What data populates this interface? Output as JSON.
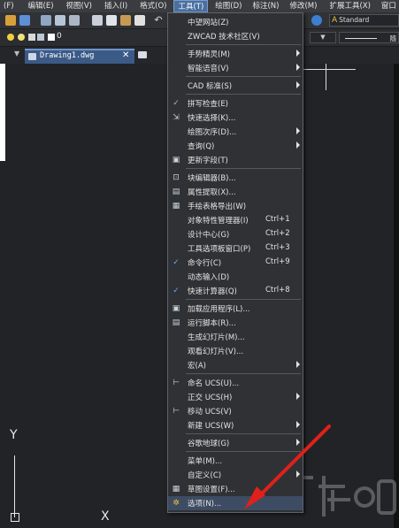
{
  "menubar": {
    "items": [
      "(F)",
      "编辑(E)",
      "视图(V)",
      "插入(I)",
      "格式(O)",
      "工具(T)",
      "绘图(D)",
      "标注(N)",
      "修改(M)",
      "扩展工具(X)",
      "窗口"
    ],
    "active_index": 5
  },
  "toolbar": {
    "text_style": "Standard",
    "undo_icon": "undo-icon"
  },
  "layerbar": {
    "current_layer": "0",
    "lineweight_label": "随"
  },
  "tabs": [
    {
      "label": "Drawing1.dwg"
    }
  ],
  "canvas": {
    "ucs_y": "Y",
    "ucs_x": "X"
  },
  "tools_menu": {
    "items": [
      {
        "label": "中望网站(Z)",
        "shortcut": "",
        "submenu": false,
        "icon": ""
      },
      {
        "label": "ZWCAD 技术社区(V)",
        "shortcut": "",
        "submenu": false,
        "icon": ""
      },
      {
        "label": "手势精灵(M)",
        "shortcut": "",
        "submenu": true,
        "icon": ""
      },
      {
        "label": "智能语音(V)",
        "shortcut": "",
        "submenu": true,
        "icon": ""
      },
      {
        "label": "CAD 标准(S)",
        "shortcut": "",
        "submenu": true,
        "icon": ""
      },
      {
        "label": "拼写检查(E)",
        "shortcut": "",
        "submenu": false,
        "icon": "spell-check-icon"
      },
      {
        "label": "快速选择(K)...",
        "shortcut": "",
        "submenu": false,
        "icon": "quick-select-icon"
      },
      {
        "label": "绘图次序(D)...",
        "shortcut": "",
        "submenu": true,
        "icon": ""
      },
      {
        "label": "查询(Q)",
        "shortcut": "",
        "submenu": true,
        "icon": ""
      },
      {
        "label": "更新字段(T)",
        "shortcut": "",
        "submenu": false,
        "icon": "update-field-icon"
      },
      {
        "label": "块编辑器(B)...",
        "shortcut": "",
        "submenu": false,
        "icon": "block-editor-icon"
      },
      {
        "label": "属性提取(X)...",
        "shortcut": "",
        "submenu": false,
        "icon": "attribute-extract-icon"
      },
      {
        "label": "手绘表格导出(W)",
        "shortcut": "",
        "submenu": false,
        "icon": "table-export-icon"
      },
      {
        "label": "对象特性管理器(I)",
        "shortcut": "Ctrl+1",
        "submenu": false,
        "icon": ""
      },
      {
        "label": "设计中心(G)",
        "shortcut": "Ctrl+2",
        "submenu": false,
        "icon": ""
      },
      {
        "label": "工具选项板窗口(P)",
        "shortcut": "Ctrl+3",
        "submenu": false,
        "icon": ""
      },
      {
        "label": "命令行(C)",
        "shortcut": "Ctrl+9",
        "submenu": false,
        "icon": "checkmark-icon"
      },
      {
        "label": "动态输入(D)",
        "shortcut": "",
        "submenu": false,
        "icon": ""
      },
      {
        "label": "快速计算器(Q)",
        "shortcut": "Ctrl+8",
        "submenu": false,
        "icon": "checkmark-icon"
      },
      {
        "label": "加载应用程序(L)...",
        "shortcut": "",
        "submenu": false,
        "icon": "load-app-icon"
      },
      {
        "label": "运行脚本(R)...",
        "shortcut": "",
        "submenu": false,
        "icon": "run-script-icon"
      },
      {
        "label": "生成幻灯片(M)...",
        "shortcut": "",
        "submenu": false,
        "icon": ""
      },
      {
        "label": "观看幻灯片(V)...",
        "shortcut": "",
        "submenu": false,
        "icon": ""
      },
      {
        "label": "宏(A)",
        "shortcut": "",
        "submenu": true,
        "icon": ""
      },
      {
        "label": "命名 UCS(U)...",
        "shortcut": "",
        "submenu": false,
        "icon": "named-ucs-icon"
      },
      {
        "label": "正交 UCS(H)",
        "shortcut": "",
        "submenu": true,
        "icon": ""
      },
      {
        "label": "移动 UCS(V)",
        "shortcut": "",
        "submenu": false,
        "icon": "move-ucs-icon"
      },
      {
        "label": "新建 UCS(W)",
        "shortcut": "",
        "submenu": true,
        "icon": ""
      },
      {
        "label": "谷歌地球(G)",
        "shortcut": "",
        "submenu": true,
        "icon": ""
      },
      {
        "label": "菜单(M)...",
        "shortcut": "",
        "submenu": false,
        "icon": ""
      },
      {
        "label": "自定义(C)",
        "shortcut": "",
        "submenu": true,
        "icon": ""
      },
      {
        "label": "草图设置(F)...",
        "shortcut": "",
        "submenu": false,
        "icon": "drafting-settings-icon"
      },
      {
        "label": "选项(N)...",
        "shortcut": "",
        "submenu": false,
        "icon": "gear-icon"
      }
    ]
  },
  "colors": {
    "menubar_bg": "#3a3c40",
    "menu_bg": "#2f3135",
    "canvas_bg": "#212327",
    "active_tab": "#3b5a86",
    "arrow_red": "#e0201a"
  }
}
